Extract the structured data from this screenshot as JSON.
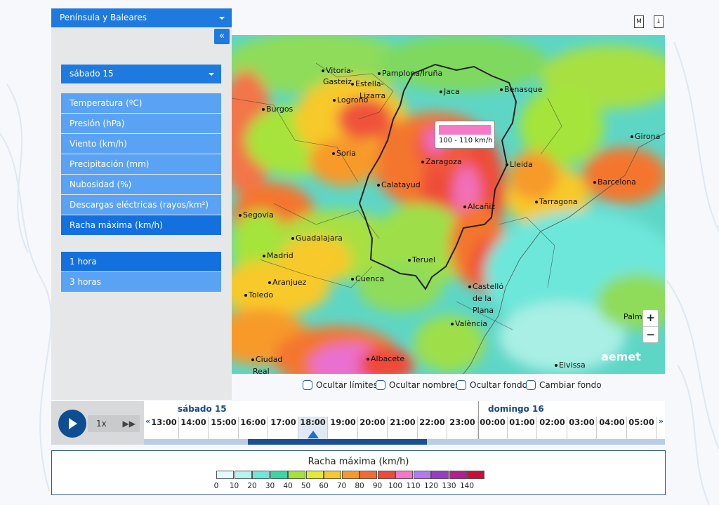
{
  "sidebar": {
    "region_select": "Península y Baleares",
    "collapse_label": "«",
    "day_select": "sábado 15",
    "variables": [
      {
        "label": "Temperatura (ºC)",
        "active": false
      },
      {
        "label": "Presión (hPa)",
        "active": false
      },
      {
        "label": "Viento (km/h)",
        "active": false
      },
      {
        "label": "Precipitación (mm)",
        "active": false
      },
      {
        "label": "Nubosidad (%)",
        "active": false
      },
      {
        "label": "Descargas eléctricas (rayos/km²)",
        "active": false
      },
      {
        "label": "Racha máxima (km/h)",
        "active": true
      }
    ],
    "intervals": [
      {
        "label": "1 hora",
        "active": true
      },
      {
        "label": "3 horas",
        "active": false
      }
    ]
  },
  "top_icons": {
    "m_icon": "M",
    "download_icon": "↓"
  },
  "map": {
    "cities": [
      "Vitoria-",
      "Gasteiz",
      "Pamplona/Iruña",
      "Estella-",
      "Lizarra",
      "Logroño",
      "Jaca",
      "Benasque",
      "Burgos",
      "Soria",
      "Zaragoza",
      "Lleida",
      "Girona",
      "Barcelona",
      "Calatayud",
      "Tarragona",
      "Alcañiz",
      "Segovia",
      "Guadalajara",
      "Madrid",
      "Teruel",
      "Aranjuez",
      "Cuenca",
      "Toledo",
      "Castelló",
      "de la",
      "Plana",
      "València",
      "Palma",
      "Ciudad",
      "Real",
      "Albacete",
      "Eivissa"
    ],
    "tooltip_text": "100 - 110 km/h",
    "zoom_in": "+",
    "zoom_out": "−",
    "logo": "aemet",
    "colors": {
      "tooltip_swatch": "#f679c5"
    }
  },
  "toggles": [
    {
      "label": "Ocultar límites"
    },
    {
      "label": "Ocultar nombres"
    },
    {
      "label": "Ocultar fondo"
    },
    {
      "label": "Cambiar fondo"
    }
  ],
  "timeline": {
    "speed": "1x",
    "ff": "▶▶",
    "prev": "«",
    "next": "»",
    "day1": "sábado 15",
    "day2": "domingo 16",
    "hours": [
      "13:00",
      "14:00",
      "15:00",
      "16:00",
      "17:00",
      "18:00",
      "19:00",
      "20:00",
      "21:00",
      "22:00",
      "23:00",
      "00:00",
      "01:00",
      "02:00",
      "03:00",
      "04:00",
      "05:00"
    ],
    "selected": "18:00"
  },
  "legend": {
    "title": "Racha máxima (km/h)",
    "ticks": [
      "0",
      "10",
      "20",
      "30",
      "40",
      "50",
      "60",
      "70",
      "80",
      "90",
      "100",
      "110",
      "120",
      "130",
      "140"
    ],
    "colors": [
      "#e4fbfb",
      "#b6f4ee",
      "#6de7da",
      "#35d9a4",
      "#a4e43a",
      "#e3ec2e",
      "#f7c92a",
      "#f79a2c",
      "#f46b2e",
      "#f04a38",
      "#f676c8",
      "#b678ef",
      "#9a3bc8",
      "#b51e8c",
      "#c80f3a"
    ]
  }
}
